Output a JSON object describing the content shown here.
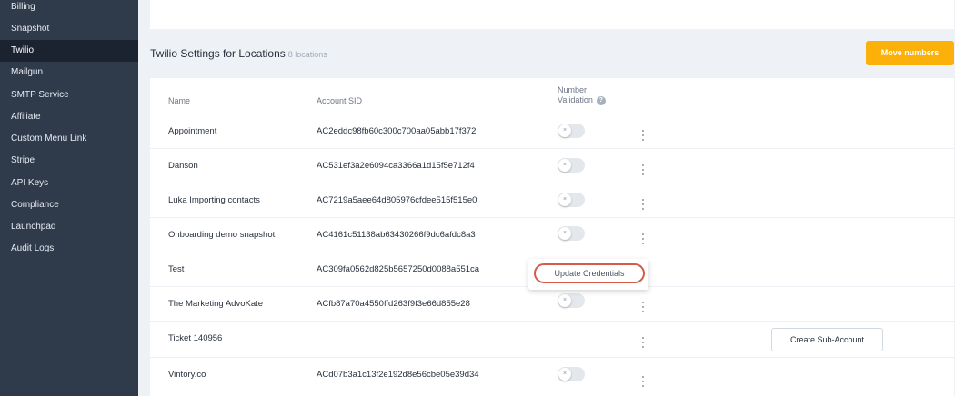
{
  "sidebar": {
    "items": [
      {
        "label": "Billing",
        "active": false
      },
      {
        "label": "Snapshot",
        "active": false
      },
      {
        "label": "Twilio",
        "active": true
      },
      {
        "label": "Mailgun",
        "active": false
      },
      {
        "label": "SMTP Service",
        "active": false
      },
      {
        "label": "Affiliate",
        "active": false
      },
      {
        "label": "Custom Menu Link",
        "active": false
      },
      {
        "label": "Stripe",
        "active": false
      },
      {
        "label": "API Keys",
        "active": false
      },
      {
        "label": "Compliance",
        "active": false
      },
      {
        "label": "Launchpad",
        "active": false
      },
      {
        "label": "Audit Logs",
        "active": false
      }
    ]
  },
  "page": {
    "title": "Twilio Settings for Locations",
    "count": "8 locations",
    "move_button": "Move numbers"
  },
  "table": {
    "headers": {
      "name": "Name",
      "sid": "Account SID",
      "validation_line1": "Number",
      "validation_line2": "Validation"
    },
    "rows": [
      {
        "name": "Appointment",
        "sid": "AC2eddc98fb60c300c700aa05abb17f372",
        "toggle": "off"
      },
      {
        "name": "Danson",
        "sid": "AC531ef3a2e6094ca3366a1d15f5e712f4",
        "toggle": "off"
      },
      {
        "name": "Luka Importing contacts",
        "sid": "AC7219a5aee64d805976cfdee515f515e0",
        "toggle": "off"
      },
      {
        "name": "Onboarding demo snapshot",
        "sid": "AC4161c51138ab63430266f9dc6afdc8a3",
        "toggle": "off"
      },
      {
        "name": "Test",
        "sid": "AC309fa0562d825b5657250d0088a551ca",
        "toggle": "hidden"
      },
      {
        "name": "The Marketing AdvoKate",
        "sid": "ACfb87a70a4550ffd263f9f3e66d855e28",
        "toggle": "off"
      },
      {
        "name": "Ticket 140956",
        "sid": "",
        "toggle": "none"
      },
      {
        "name": "Vintory.co",
        "sid": "ACd07b3a1c13f2e192d8e56cbe05e39d34",
        "toggle": "off"
      }
    ]
  },
  "dropdown": {
    "item": "Update Credentials"
  },
  "create_sub_account": "Create Sub-Account",
  "colors": {
    "sidebar_bg": "#2f3a4b",
    "sidebar_active": "#1b2331",
    "accent": "#fbb00a",
    "highlight_outline": "#d65a45"
  },
  "icons": {
    "toggle_knob": "×",
    "help": "?"
  }
}
